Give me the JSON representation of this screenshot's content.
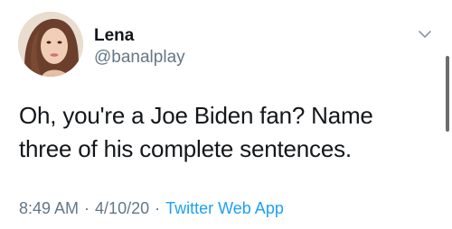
{
  "user": {
    "name": "Lena",
    "handle": "@banalplay"
  },
  "tweet": {
    "line1": "Oh, you're a Joe Biden fan? Name",
    "line2": "three of his complete sentences."
  },
  "meta": {
    "time": "8:49 AM",
    "separator": "·",
    "date": "4/10/20",
    "source": "Twitter Web App"
  },
  "icons": {
    "menu": "chevron-down-icon"
  },
  "colors": {
    "link": "#1da1f2",
    "secondary_text": "#657786",
    "primary_text": "#14171a"
  }
}
